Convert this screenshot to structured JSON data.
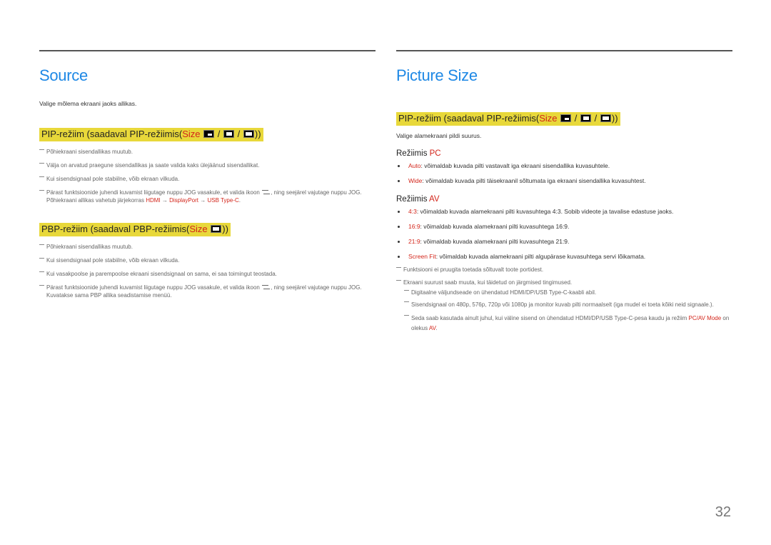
{
  "page_number": "32",
  "left": {
    "title": "Source",
    "intro": "Valige mõlema ekraani jaoks allikas.",
    "pip_heading": {
      "prefix": "PIP-režiim (saadaval PIP-režiimis(",
      "size_word": "Size",
      "sep": "/",
      "suffix": "))"
    },
    "pip_notes": [
      "Põhiekraani sisendallikas muutub.",
      "Välja on arvatud praegune sisendallikas ja saate valida kaks ülejäänud sisendallikat.",
      "Kui sisendsignaal pole stabiilne, võib ekraan vilkuda."
    ],
    "pip_jog_note": {
      "before": "Pärast funktsioonide juhendi kuvamist liigutage nuppu JOG vasakule, et valida ikoon ",
      "after": ", ning seejärel vajutage nuppu JOG. Põhiekraani allikas vahetub järjekorras ",
      "src1": "HDMI",
      "arrow": " → ",
      "src2": "DisplayPort",
      "src3": "USB Type-C",
      "end": "."
    },
    "pbp_heading": {
      "prefix": "PBP-režiim (saadaval PBP-režiimis(",
      "size_word": "Size",
      "suffix": "))"
    },
    "pbp_notes": [
      "Põhiekraani sisendallikas muutub.",
      "Kui sisendsignaal pole stabiilne, võib ekraan vilkuda.",
      "Kui vasakpoolse ja parempoolse ekraani sisendsignaal on sama, ei saa toimingut teostada."
    ],
    "pbp_jog_note": {
      "before": "Pärast funktsioonide juhendi kuvamist liigutage nuppu JOG vasakule, et valida ikoon ",
      "after": ", ning seejärel vajutage nuppu JOG. Kuvatakse sama PBP allika seadistamise menüü."
    }
  },
  "right": {
    "title": "Picture Size",
    "pip_heading": {
      "prefix": "PIP-režiim (saadaval PIP-režiimis(",
      "size_word": "Size",
      "sep": "/",
      "suffix": "))"
    },
    "intro": "Valige alamekraani pildi suurus.",
    "pc_heading": {
      "prefix": "Režiimis ",
      "mode": "PC"
    },
    "pc_items": [
      {
        "key": "Auto",
        "text": ": võimaldab kuvada pilti vastavalt iga ekraani sisendallika kuvasuhtele."
      },
      {
        "key": "Wide",
        "text": ": võimaldab kuvada pilti täisekraanil sõltumata iga ekraani sisendallika kuvasuhtest."
      }
    ],
    "av_heading": {
      "prefix": "Režiimis ",
      "mode": "AV"
    },
    "av_items": [
      {
        "key": "4:3",
        "text": ": võimaldab kuvada alamekraani pilti kuvasuhtega 4:3. Sobib videote ja tavalise edastuse jaoks."
      },
      {
        "key": "16:9",
        "text": ": võimaldab kuvada alamekraani pilti kuvasuhtega 16:9."
      },
      {
        "key": "21:9",
        "text": ": võimaldab kuvada alamekraani pilti kuvasuhtega 21:9."
      },
      {
        "key": "Screen Fit",
        "text": ": võimaldab kuvada alamekraani pilti algupärase kuvasuhtega servi lõikamata."
      }
    ],
    "notes": [
      "Funktsiooni ei pruugita toetada sõltuvalt toote portidest.",
      "Ekraani suurust saab muuta, kui täidetud on järgmised tingimused."
    ],
    "sub_notes": [
      "Digitaalne väljundseade on ühendatud HDMI/DP/USB Type-C-kaabli abil.",
      "Sisendsignaal on 480p, 576p, 720p või 1080p ja monitor kuvab pilti normaalselt (iga mudel ei toeta kõiki neid signaale.)."
    ],
    "last_sub_note": {
      "before": "Seda saab kasutada ainult juhul, kui väline sisend on ühendatud HDMI/DP/USB Type-C-pesa kaudu ja režiim ",
      "mode_name": "PC/AV Mode",
      "mid": " on olekus ",
      "value": "AV",
      "end": "."
    }
  }
}
